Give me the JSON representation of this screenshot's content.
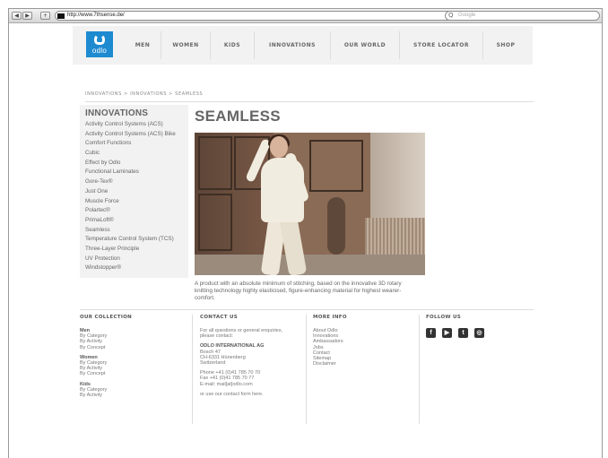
{
  "browser": {
    "url": "http://www.7thsense.de/",
    "search_placeholder": "Google",
    "back_icon": "◀",
    "forward_icon": "▶",
    "add_icon": "+",
    "reload_icon": "C",
    "search_icon": "Q"
  },
  "header": {
    "logo_text": "odlo",
    "menu": [
      "MEN",
      "WOMEN",
      "KIDS",
      "INNOVATIONS",
      "OUR WORLD",
      "STORE LOCATOR",
      "SHOP"
    ]
  },
  "breadcrumb": "INNOVATIONS  >  INNOVATIONS  >  SEAMLESS",
  "sidebar": {
    "title": "INNOVATIONS",
    "items": [
      "Activity Control Systems (ACS)",
      "Activity Control Systems (ACS) Bike",
      "Comfort Functions",
      "Cubic",
      "Effect by Odlo",
      "Functional Laminates",
      "Gore-Tex®",
      "Just One",
      "Muscle Force",
      "Polartec®",
      "PrimaLoft®",
      "Seamless",
      "Temperature Control System (TCS)",
      "Three-Layer Principle",
      "UV Protection",
      "Windstopper®"
    ]
  },
  "main": {
    "title": "SEAMLESS",
    "description": "A product with an absolute minimum of stitching, based on the innovative 3D rotary knitting technology highly elasticised, figure-enhancing material for highest wearer-comfort."
  },
  "footer": {
    "collection": {
      "heading": "OUR COLLECTION",
      "men": {
        "title": "Men",
        "links": [
          "By Category",
          "By Activity",
          "By Concept"
        ]
      },
      "women": {
        "title": "Women",
        "links": [
          "By Category",
          "By Activity",
          "By Concept"
        ]
      },
      "kids": {
        "title": "Kids",
        "links": [
          "By Category",
          "By Activity"
        ]
      }
    },
    "contact": {
      "heading": "CONTACT US",
      "intro": [
        "For all questions or general enquiries,",
        "please contact:"
      ],
      "company": "ODLO INTERNATIONAL AG",
      "address": [
        "Bosch 47",
        "CH-6331 Hünenberg",
        "Switzerland"
      ],
      "phone": [
        "Phone +41 (0)41 785 70 70",
        "Fax +41 (0)41 785 70 77",
        "E-mail: mail[at]odlo.com"
      ],
      "form_text": "or use our contact form here."
    },
    "more_info": {
      "heading": "MORE INFO",
      "links": [
        "About Odlo",
        "Innovations",
        "Ambassadors",
        "Jobs",
        "Contact",
        "Sitemap",
        "Disclaimer"
      ]
    },
    "follow_us": {
      "heading": "FOLLOW US",
      "icons": [
        "facebook-icon",
        "youtube-icon",
        "twitter-icon",
        "instagram-icon"
      ],
      "glyphs": [
        "f",
        "▶",
        "t",
        "◎"
      ]
    }
  }
}
